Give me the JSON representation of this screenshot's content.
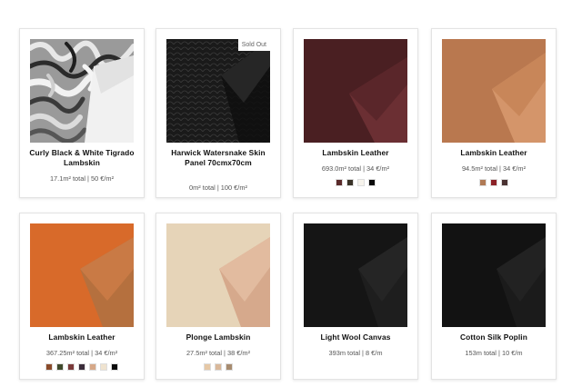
{
  "products": [
    {
      "title": "Curly Black & White Tigrado Lambskin",
      "meta": "17.1m² total | 50 €/m²",
      "badge": "",
      "image": "curly-fur",
      "swatches": []
    },
    {
      "title": "Harwick Watersnake Skin Panel 70cmx70cm",
      "meta": "0m² total | 100 €/m²",
      "badge": "Sold Out",
      "image": "snake-skin",
      "swatches": []
    },
    {
      "title": "Lambskin Leather",
      "meta": "693.0m² total | 34 €/m²",
      "badge": "",
      "image": "leather-burgundy",
      "swatches": [
        "#5a2a2a",
        "#3a3328",
        "#f6f3ec",
        "#0b0b0b"
      ]
    },
    {
      "title": "Lambskin Leather",
      "meta": "94.5m² total | 34 €/m²",
      "badge": "",
      "image": "leather-tan",
      "swatches": [
        "#b07a55",
        "#8c2228",
        "#4a3232"
      ]
    },
    {
      "title": "Lambskin Leather",
      "meta": "367.25m² total | 34 €/m²",
      "badge": "",
      "image": "leather-orange",
      "swatches": [
        "#8a4a2a",
        "#3f4a2c",
        "#7a3a3a",
        "#3a2c3a",
        "#d6a888",
        "#efe3cf",
        "#0a0a0a"
      ]
    },
    {
      "title": "Plonge Lambskin",
      "meta": "27.5m² total | 38 €/m²",
      "badge": "",
      "image": "leather-cream",
      "swatches": [
        "#e6c8a6",
        "#d9b89a",
        "#a78b6f"
      ]
    },
    {
      "title": "Light Wool Canvas",
      "meta": "393m total | 8 €/m",
      "badge": "",
      "image": "wool-black",
      "swatches": []
    },
    {
      "title": "Cotton Silk Poplin",
      "meta": "153m total | 10 €/m",
      "badge": "",
      "image": "poplin-black",
      "swatches": []
    }
  ]
}
